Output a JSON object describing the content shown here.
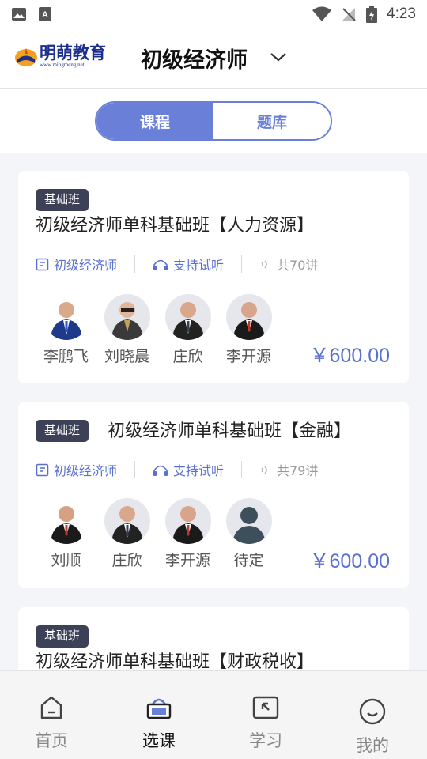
{
  "status_bar": {
    "time": "4:23"
  },
  "header": {
    "logo_text": "明萌教育",
    "logo_url": "www.mingmeng.net",
    "title": "初级经济师"
  },
  "tabs": [
    {
      "label": "课程",
      "active": true
    },
    {
      "label": "题库",
      "active": false
    }
  ],
  "courses": [
    {
      "badge": "基础班",
      "title": "初级经济师单科基础班【人力资源】",
      "category": "初级经济师",
      "trial": "支持试听",
      "lessons": "共70讲",
      "teachers": [
        "李鹏飞",
        "刘晓晨",
        "庄欣",
        "李开源"
      ],
      "price": "￥600.00"
    },
    {
      "badge": "基础班",
      "title": "初级经济师单科基础班【金融】",
      "category": "初级经济师",
      "trial": "支持试听",
      "lessons": "共79讲",
      "teachers": [
        "刘顺",
        "庄欣",
        "李开源",
        "待定"
      ],
      "price": "￥600.00"
    },
    {
      "badge": "基础班",
      "title": "初级经济师单科基础班【财政税收】"
    }
  ],
  "nav": [
    {
      "label": "首页",
      "icon": "home-icon",
      "active": false
    },
    {
      "label": "选课",
      "icon": "basket-icon",
      "active": true
    },
    {
      "label": "学习",
      "icon": "study-icon",
      "active": false
    },
    {
      "label": "我的",
      "icon": "profile-icon",
      "active": false
    }
  ],
  "colors": {
    "accent": "#6a7fd8",
    "price": "#5a70cf",
    "badge": "#3d4157"
  }
}
